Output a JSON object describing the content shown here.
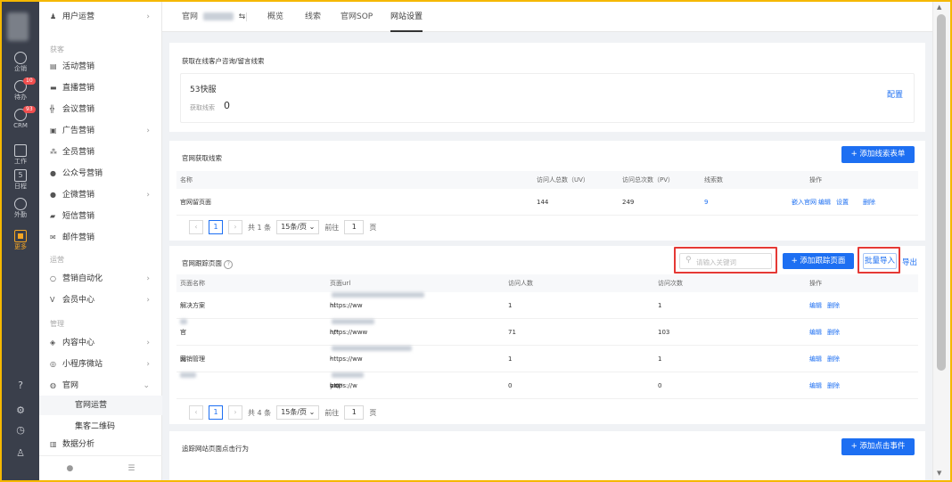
{
  "rail": {
    "items": [
      {
        "label": "企销",
        "icon": "circle-icon"
      },
      {
        "label": "待办",
        "icon": "check-circle-icon",
        "badge": "10"
      },
      {
        "label": "CRM",
        "icon": "crm-icon",
        "badge": "93"
      },
      {
        "label": "工作",
        "icon": "calendar-icon"
      },
      {
        "label": "日程",
        "icon": "schedule-icon",
        "num": "5"
      },
      {
        "label": "外勤",
        "icon": "location-icon"
      },
      {
        "label": "更多",
        "icon": "grid-icon"
      }
    ]
  },
  "sidebar": {
    "top_item": "用户运营",
    "group_acquire": "获客",
    "items_acquire": [
      "活动营销",
      "直播营销",
      "会议营销",
      "广告营销",
      "全员营销",
      "公众号营销",
      "企微营销",
      "短信营销",
      "邮件营销"
    ],
    "group_operate": "运营",
    "items_operate": [
      "营销自动化",
      "会员中心"
    ],
    "group_manage": "管理",
    "items_manage": [
      "内容中心",
      "小程序微站",
      "官网"
    ],
    "sub_items": [
      "官网运营",
      "集客二维码"
    ],
    "last_item": "数据分析"
  },
  "tabs": {
    "site_prefix": "官网",
    "switch_icon": "⇆",
    "items": [
      "概览",
      "线索",
      "官网SOP",
      "网站设置"
    ],
    "active": "网站设置"
  },
  "section1": {
    "title": "获取在线客户咨询/留言线索",
    "provider": "53快服",
    "leads_label": "获取线索",
    "leads_value": "0",
    "config_link": "配置"
  },
  "section2": {
    "title": "官网获取线索",
    "add_button": "+ 添加线索表单",
    "columns": [
      "名称",
      "访问人总数（UV）",
      "访问总次数（PV）",
      "线索数",
      "操作"
    ],
    "rows": [
      {
        "name": "官网留页面",
        "uv": "144",
        "pv": "249",
        "leads": "9",
        "actions": [
          "嵌入官网",
          "编辑",
          "设置",
          "删除"
        ]
      }
    ],
    "pager": {
      "total": "共 1 条",
      "page": "1",
      "size": "15条/页",
      "goto": "前往",
      "goto_val": "1",
      "page_unit": "页"
    }
  },
  "section3": {
    "title": "官网跟踪页面",
    "search_placeholder": "请输入关键词",
    "add_button": "+ 添加跟踪页面",
    "import_button": "批量导入",
    "export_button": "导出",
    "columns": [
      "页面名称",
      "页面url",
      "访问人数",
      "访问次数",
      "操作"
    ],
    "rows": [
      {
        "name": "解决方案",
        "url_prefix": "https://ww",
        "url_suffix": "nl",
        "visitors": "1",
        "visits": "1"
      },
      {
        "name": "官网",
        "url_prefix": "https://www",
        "url_suffix": "n/*",
        "visitors": "71",
        "visits": "103"
      },
      {
        "name": "营销管理",
        "url_prefix": "https://ww",
        "url_suffix": "-yx/",
        "visitors": "1",
        "visits": "1"
      },
      {
        "name": "",
        "url_prefix": "https://w",
        "url_suffix": "om*",
        "visitors": "0",
        "visits": "0"
      }
    ],
    "row_actions": [
      "编辑",
      "删除"
    ],
    "pager": {
      "total": "共 4 条",
      "page": "1",
      "size": "15条/页",
      "goto": "前往",
      "goto_val": "1",
      "page_unit": "页"
    }
  },
  "section4": {
    "title": "追踪网站页面点击行为",
    "add_button": "+ 添加点击事件"
  },
  "colors": {
    "primary": "#1d6ff2",
    "highlight": "#e53935",
    "frame": "#f5b800"
  }
}
